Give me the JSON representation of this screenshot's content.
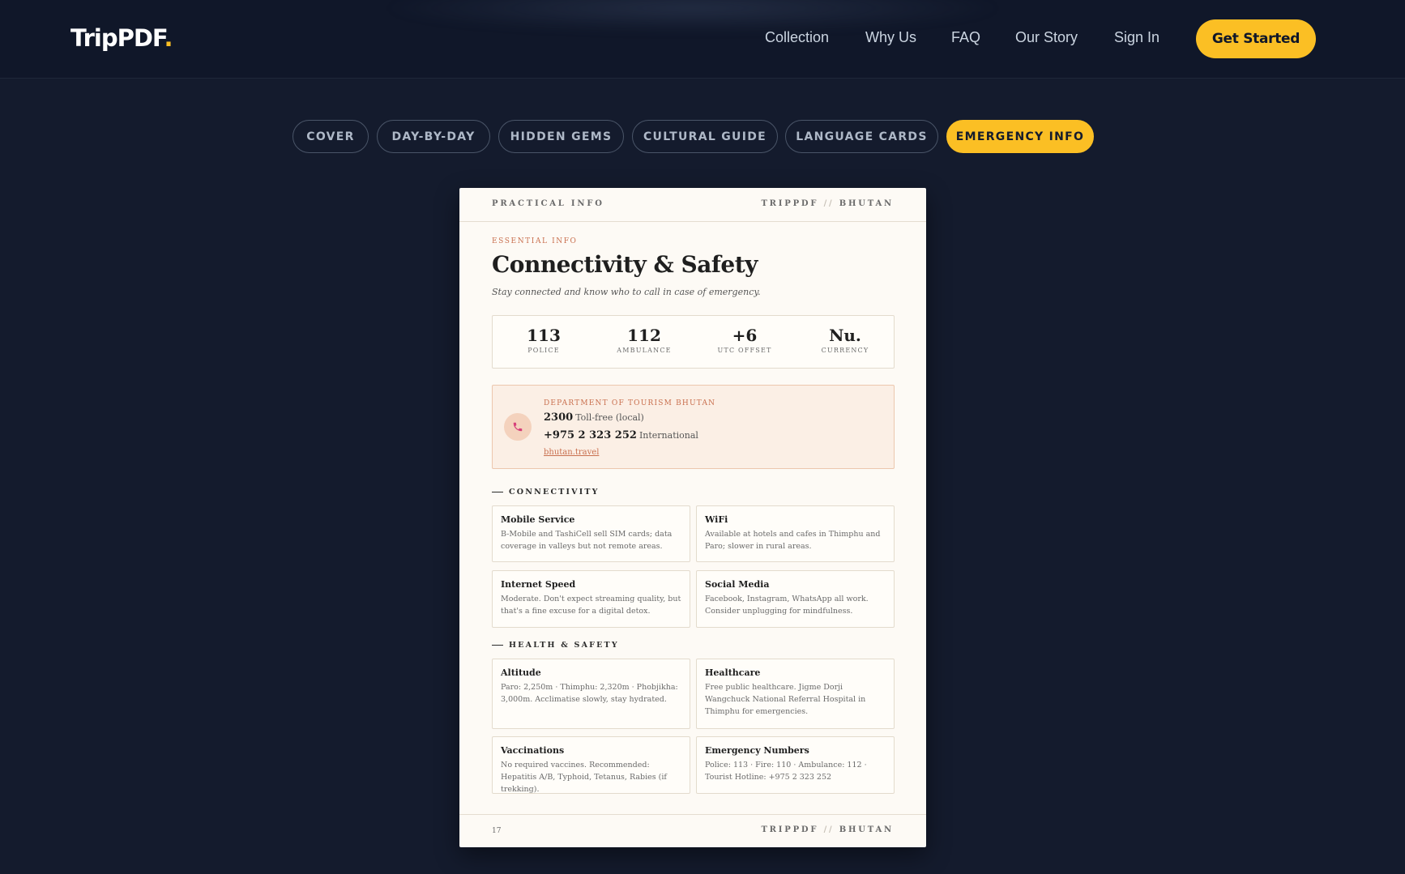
{
  "nav": {
    "logo_text": "TripPDF",
    "logo_dot": ".",
    "links": [
      "Collection",
      "Why Us",
      "FAQ",
      "Our Story",
      "Sign In"
    ],
    "cta": "Get Started"
  },
  "tabs": [
    {
      "label": "COVER",
      "active": false
    },
    {
      "label": "DAY-BY-DAY",
      "active": false
    },
    {
      "label": "HIDDEN GEMS",
      "active": false
    },
    {
      "label": "CULTURAL GUIDE",
      "active": false
    },
    {
      "label": "LANGUAGE CARDS",
      "active": false
    },
    {
      "label": "EMERGENCY INFO",
      "active": true
    }
  ],
  "page": {
    "header_left": "PRACTICAL INFO",
    "brand_a": "TRIPPDF",
    "brand_sep": "//",
    "brand_b": "BHUTAN",
    "eyebrow": "ESSENTIAL INFO",
    "title": "Connectivity & Safety",
    "subtitle": "Stay connected and know who to call in case of emergency.",
    "stats": [
      {
        "value": "113",
        "label": "POLICE"
      },
      {
        "value": "112",
        "label": "AMBULANCE"
      },
      {
        "value": "+6",
        "label": "UTC OFFSET"
      },
      {
        "value": "Nu.",
        "label": "CURRENCY"
      }
    ],
    "contact": {
      "org": "DEPARTMENT OF TOURISM BHUTAN",
      "local_number": "2300",
      "local_label": "Toll-free (local)",
      "intl_number": "+975 2 323 252",
      "intl_label": "International",
      "link": "bhutan.travel"
    },
    "sections": [
      {
        "heading": "CONNECTIVITY",
        "cards": [
          {
            "title": "Mobile Service",
            "body": "B-Mobile and TashiCell sell SIM cards; data coverage in valleys but not remote areas."
          },
          {
            "title": "WiFi",
            "body": "Available at hotels and cafes in Thimphu and Paro; slower in rural areas."
          },
          {
            "title": "Internet Speed",
            "body": "Moderate. Don't expect streaming quality, but that's a fine excuse for a digital detox."
          },
          {
            "title": "Social Media",
            "body": "Facebook, Instagram, WhatsApp all work. Consider unplugging for mindfulness."
          }
        ]
      },
      {
        "heading": "HEALTH & SAFETY",
        "cards": [
          {
            "title": "Altitude",
            "body": "Paro: 2,250m · Thimphu: 2,320m · Phobjikha: 3,000m. Acclimatise slowly, stay hydrated."
          },
          {
            "title": "Healthcare",
            "body": "Free public healthcare. Jigme Dorji Wangchuck National Referral Hospital in Thimphu for emergencies."
          },
          {
            "title": "Vaccinations",
            "body": "No required vaccines. Recommended: Hepatitis A/B, Typhoid, Tetanus, Rabies (if trekking)."
          },
          {
            "title": "Emergency Numbers",
            "body": "Police: 113 · Fire: 110 · Ambulance: 112 · Tourist Hotline: +975 2 323 252"
          }
        ]
      }
    ],
    "page_number": "17"
  },
  "colors": {
    "accent": "#fbbf24",
    "background": "#141b2d",
    "terracotta": "#c9704f"
  }
}
